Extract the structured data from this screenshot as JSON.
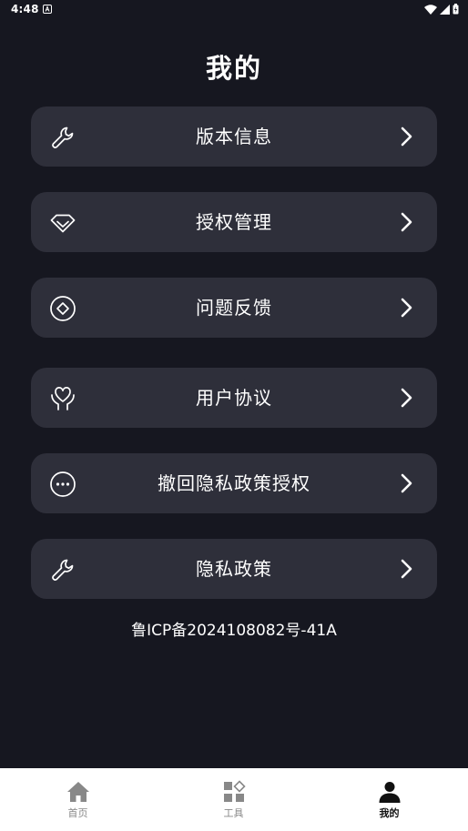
{
  "status_bar": {
    "time": "4:48"
  },
  "page": {
    "title": "我的"
  },
  "menu": {
    "items": [
      {
        "label": "版本信息",
        "icon": "wrench-icon"
      },
      {
        "label": "授权管理",
        "icon": "diamond-icon"
      },
      {
        "label": "问题反馈",
        "icon": "circle-diamond-icon"
      },
      {
        "label": "用户协议",
        "icon": "heart-hands-icon"
      },
      {
        "label": "撤回隐私政策授权",
        "icon": "more-dots-icon"
      },
      {
        "label": "隐私政策",
        "icon": "wrench-icon"
      }
    ]
  },
  "footer": {
    "icp": "鲁ICP备2024108082号-41A"
  },
  "bottom_nav": {
    "items": [
      {
        "label": "首页",
        "icon": "home-icon",
        "active": false
      },
      {
        "label": "工具",
        "icon": "tools-grid-icon",
        "active": false
      },
      {
        "label": "我的",
        "icon": "person-icon",
        "active": true
      }
    ]
  },
  "colors": {
    "background": "#161720",
    "card": "#2e2f3a",
    "text": "#ffffff",
    "nav_background": "#ffffff",
    "nav_inactive": "#888888",
    "nav_active": "#111111"
  }
}
